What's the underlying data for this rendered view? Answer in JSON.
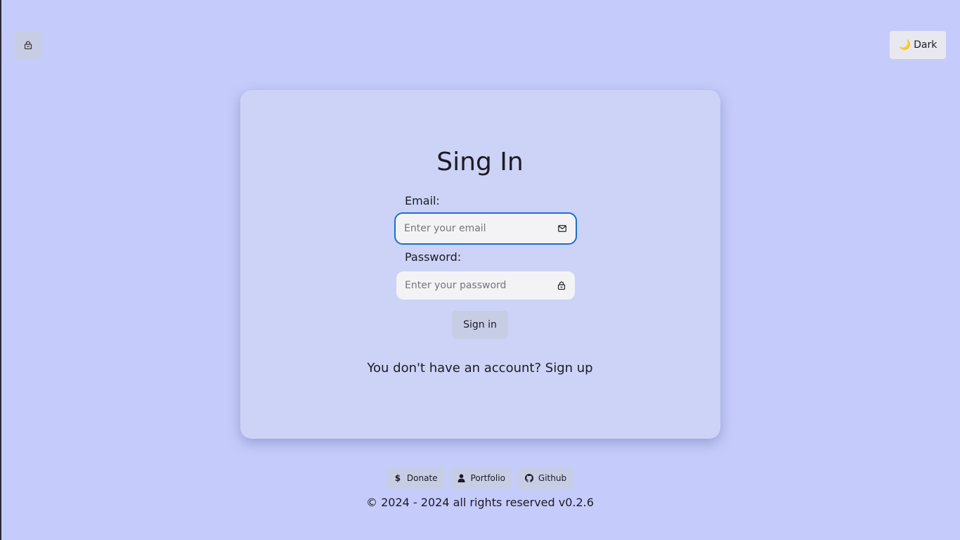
{
  "header": {
    "lock_icon": "lock-icon",
    "theme_toggle": {
      "icon": "moon-icon",
      "label": "Dark"
    }
  },
  "signin": {
    "title": "Sing In",
    "email": {
      "label": "Email:",
      "placeholder": "Enter your email",
      "value": "",
      "icon": "mail-icon"
    },
    "password": {
      "label": "Password:",
      "placeholder": "Enter your password",
      "value": "",
      "icon": "lock-icon"
    },
    "submit_label": "Sign in",
    "signup_prompt": "You don't have an account?",
    "signup_link": "Sign up"
  },
  "footer": {
    "links": [
      {
        "label": "Donate",
        "icon": "dollar-icon"
      },
      {
        "label": "Portfolio",
        "icon": "user-icon"
      },
      {
        "label": "Github",
        "icon": "github-icon"
      }
    ],
    "copyright": "© 2024 - 2024 all rights reserved v0.2.6"
  },
  "colors": {
    "background": "#c5ccfb",
    "card": "#ccd3f6",
    "focus_ring": "#1a6fd0",
    "button": "#c8cde6"
  }
}
